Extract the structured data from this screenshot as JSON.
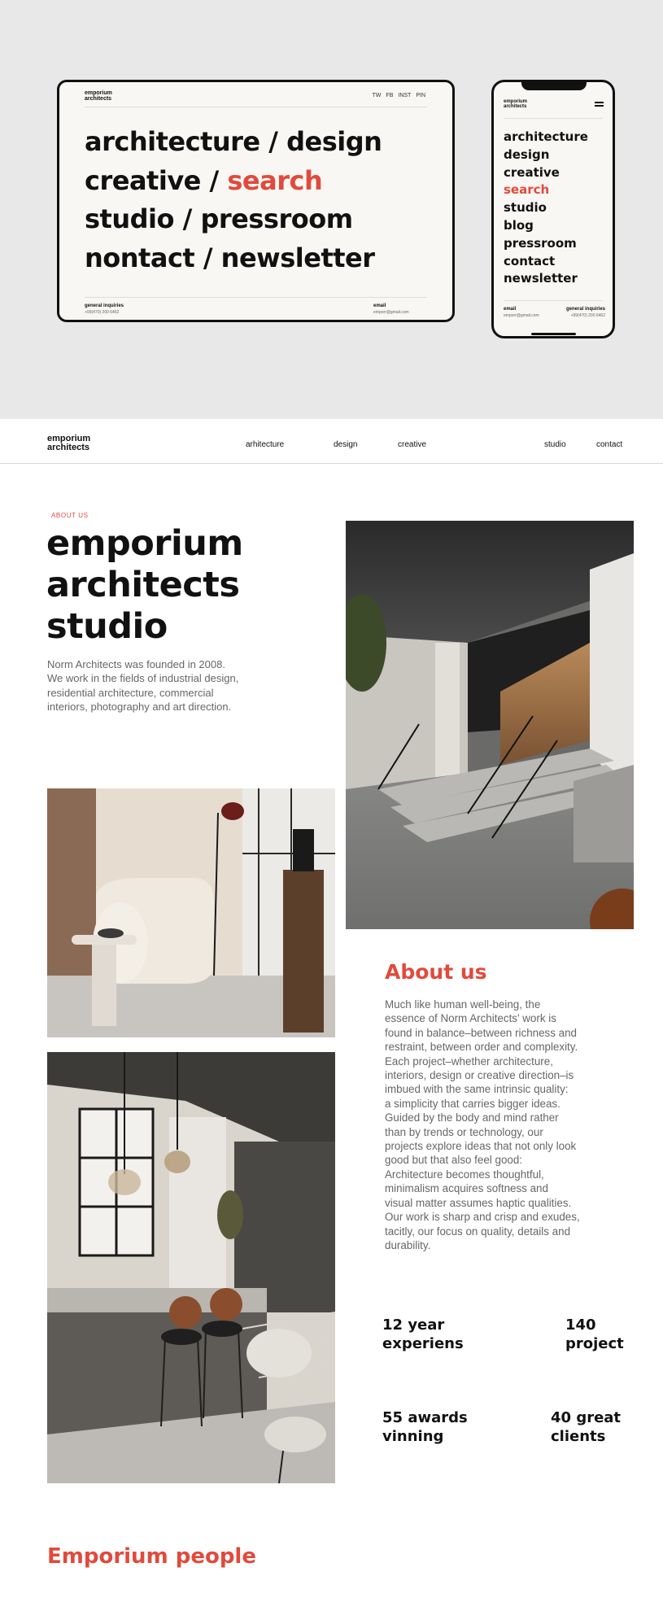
{
  "mockups": {
    "logo": [
      "emporium",
      "architects"
    ],
    "social": [
      "TW",
      "FB",
      "INST",
      "PIN"
    ],
    "tablet_menu": [
      [
        {
          "text": "architecture / design",
          "red": false
        }
      ],
      [
        {
          "text": "creative / ",
          "red": false
        },
        {
          "text": "search",
          "red": true
        }
      ],
      [
        {
          "text": "studio / pressroom",
          "red": false
        }
      ],
      [
        {
          "text": "nontact / newsletter",
          "red": false
        }
      ]
    ],
    "tablet_footer": {
      "left_label": "general inquiries",
      "left_value": "+99(470) 200 6462",
      "right_label": "email",
      "right_value": "emporr@gmail.com"
    },
    "phone_menu": [
      {
        "text": "architecture",
        "red": false
      },
      {
        "text": "design",
        "red": false
      },
      {
        "text": "creative",
        "red": false
      },
      {
        "text": "search",
        "red": true
      },
      {
        "text": "studio",
        "red": false
      },
      {
        "text": "blog",
        "red": false
      },
      {
        "text": "pressroom",
        "red": false
      },
      {
        "text": "contact",
        "red": false
      },
      {
        "text": "newsletter",
        "red": false
      }
    ],
    "phone_footer": {
      "left_label": "email",
      "left_value": "emporr@gmail.com",
      "right_label": "general inquiries",
      "right_value": "+99(470) 200 6462"
    }
  },
  "nav": {
    "logo": [
      "emporium",
      "architects"
    ],
    "links": [
      "arhitecture",
      "design",
      "creative"
    ],
    "right_links": [
      "studio",
      "contact"
    ]
  },
  "hero": {
    "eyebrow": "ABOUT US",
    "title": [
      "emporium",
      "architects",
      "studio"
    ],
    "intro": "Norm Architects was founded in 2008. We work in the fields of industrial design, residential architecture, commercial interiors, photography and art direction."
  },
  "about": {
    "heading": "About us",
    "lines": [
      "Much like human well-being, the",
      "essence of Norm Architects' work is",
      "found in balance–between richness and",
      "restraint, between order and complexity.",
      "Each project–whether architecture,",
      "interiors, design or creative direction–is",
      "imbued with the same intrinsic quality:",
      "a simplicity that carries bigger ideas.",
      "Guided by the body and mind rather",
      "than by trends or technology, our",
      "projects explore ideas that not only look",
      "good but that also feel good:",
      "Architecture becomes thoughtful,",
      "minimalism acquires softness and",
      "visual matter assumes haptic qualities.",
      "Our work is sharp and crisp and exudes,",
      "tacitly, our focus on quality, details and",
      "durability."
    ]
  },
  "stats": [
    {
      "line1": "12 year",
      "line2": "experiens"
    },
    {
      "line1": "140",
      "line2": "project"
    },
    {
      "line1": "55 awards",
      "line2": "vinning"
    },
    {
      "line1": "40 great",
      "line2": "clients"
    }
  ],
  "people": {
    "heading": "Emporium people"
  },
  "colors": {
    "accent": "#e14a3c",
    "hero_bg": "#e8e8e8",
    "mockup_bg": "#f9f7f3"
  }
}
